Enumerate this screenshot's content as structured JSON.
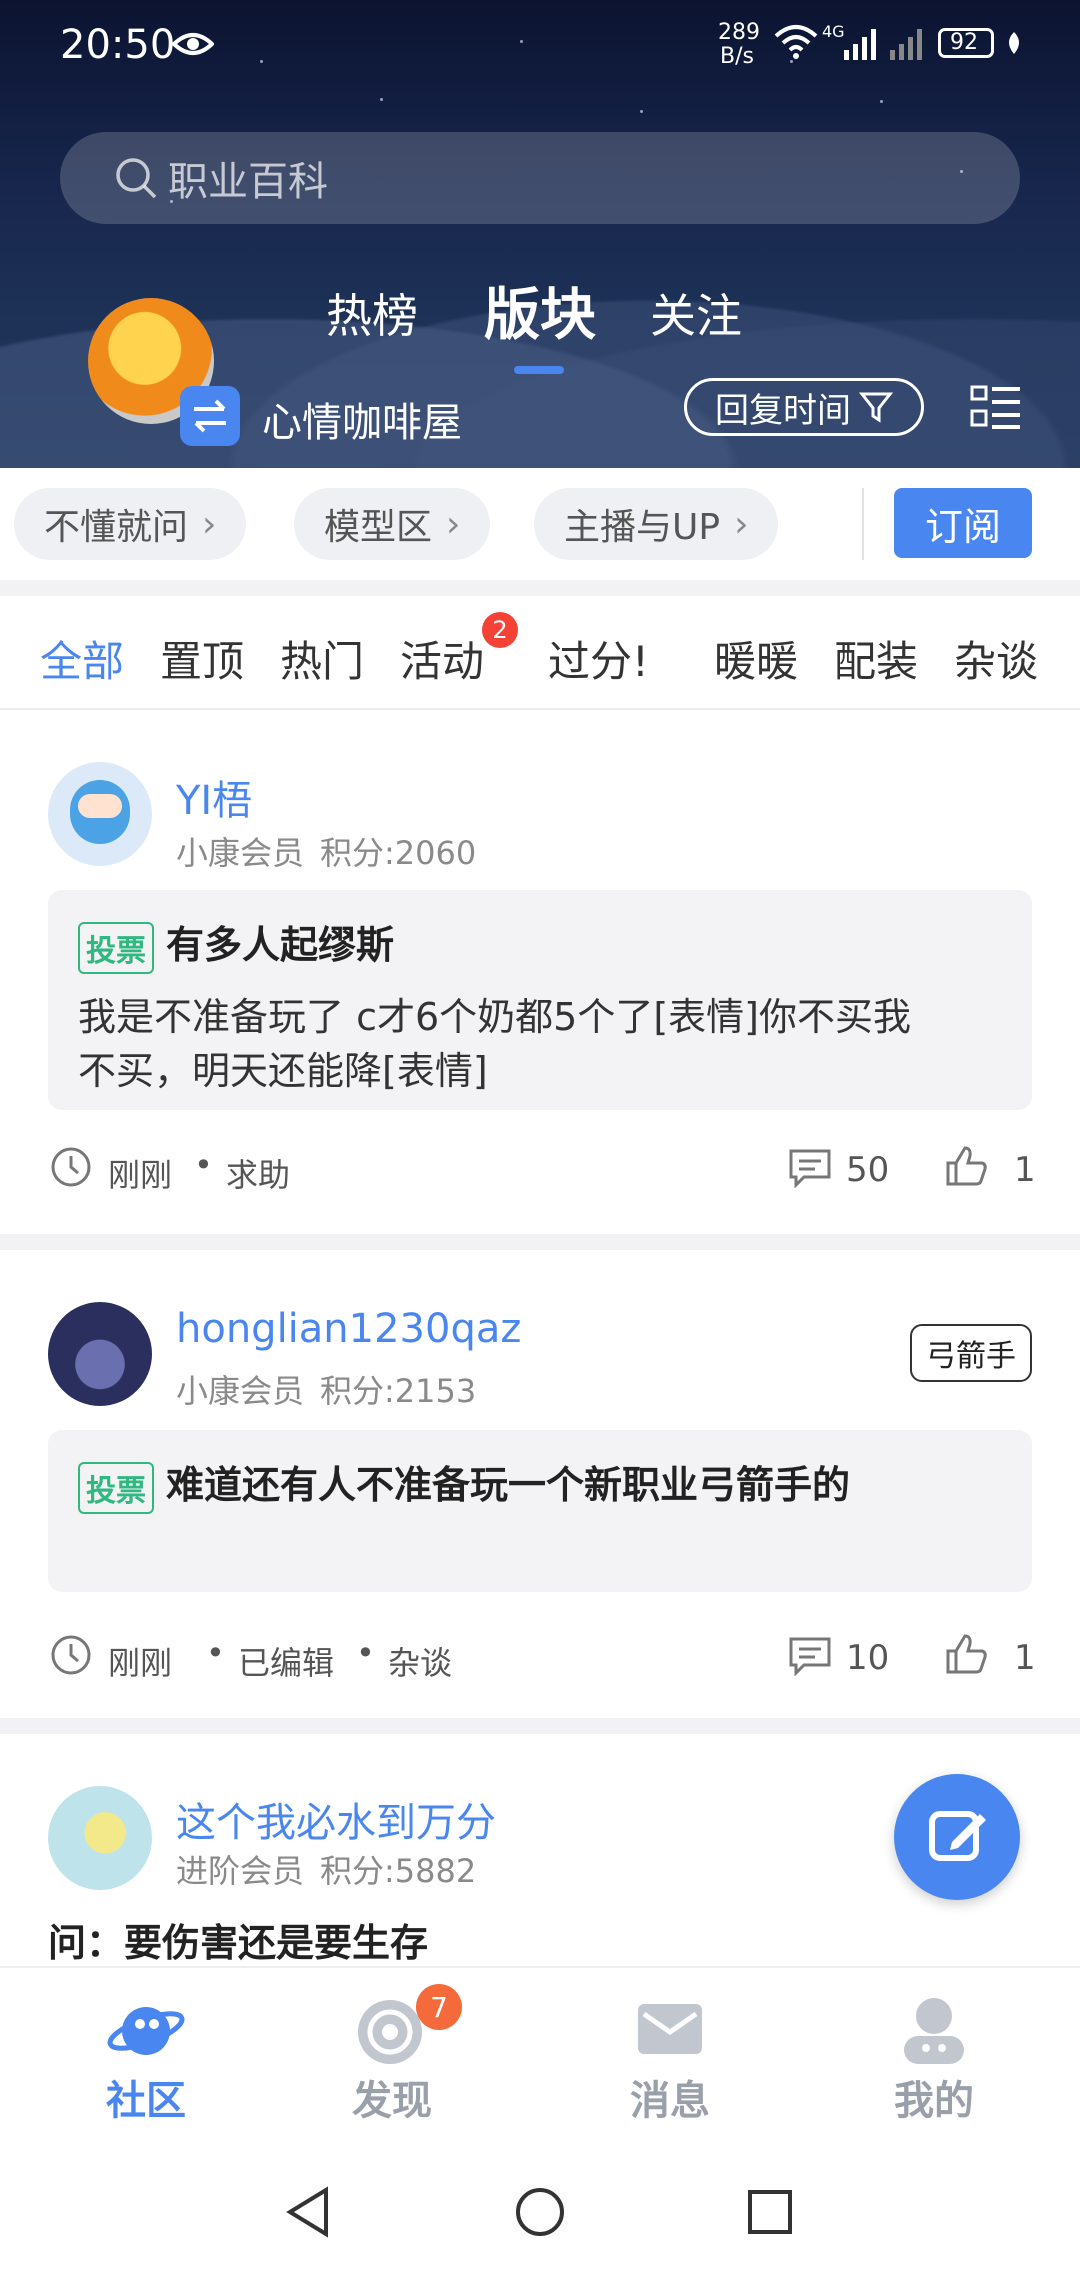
{
  "status_bar": {
    "time": "20:50",
    "net_speed_top": "289",
    "net_speed_bottom": "B/s",
    "signal_label": "4G",
    "battery": "92"
  },
  "search": {
    "placeholder": "职业百科"
  },
  "header_tabs": [
    {
      "label": "热榜"
    },
    {
      "label": "版块"
    },
    {
      "label": "关注"
    }
  ],
  "board": {
    "name": "心情咖啡屋",
    "sort_label": "回复时间"
  },
  "sub_boards": [
    {
      "label": "不懂就问"
    },
    {
      "label": "模型区"
    },
    {
      "label": "主播与UP"
    }
  ],
  "subscribe_label": "订阅",
  "categories": [
    {
      "label": "全部"
    },
    {
      "label": "置顶"
    },
    {
      "label": "热门"
    },
    {
      "label": "活动",
      "badge": "2"
    },
    {
      "label": "过分!"
    },
    {
      "label": "暖暖"
    },
    {
      "label": "配装"
    },
    {
      "label": "杂谈"
    }
  ],
  "posts": [
    {
      "username": "YI梧",
      "level": "小康会员",
      "score": "积分:2060",
      "tag": "投票",
      "title": "有多人起缪斯",
      "body_line1": "我是不准备玩了 c才6个奶都5个了[表情]你不买我",
      "body_line2": "不买，明天还能降[表情]",
      "time": "刚刚",
      "meta": [
        "求助"
      ],
      "comments": "50",
      "likes": "1"
    },
    {
      "username": "honglian1230qaz",
      "level": "小康会员",
      "score": "积分:2153",
      "badge": "弓箭手",
      "tag": "投票",
      "title": "难道还有人不准备玩一个新职业弓箭手的",
      "time": "刚刚",
      "meta": [
        "已编辑",
        "杂谈"
      ],
      "comments": "10",
      "likes": "1"
    },
    {
      "username": "这个我必水到万分",
      "level": "进阶会员",
      "score": "积分:5882",
      "title": "问：要伤害还是要生存"
    }
  ],
  "bottom_nav": [
    {
      "label": "社区",
      "icon": "planet-icon",
      "active": true
    },
    {
      "label": "发现",
      "icon": "discover-icon",
      "badge": "7"
    },
    {
      "label": "消息",
      "icon": "mail-icon"
    },
    {
      "label": "我的",
      "icon": "profile-icon"
    }
  ],
  "colors": {
    "accent": "#4a86f0",
    "vote_green": "#2fb87f",
    "badge_red": "#f44336"
  }
}
